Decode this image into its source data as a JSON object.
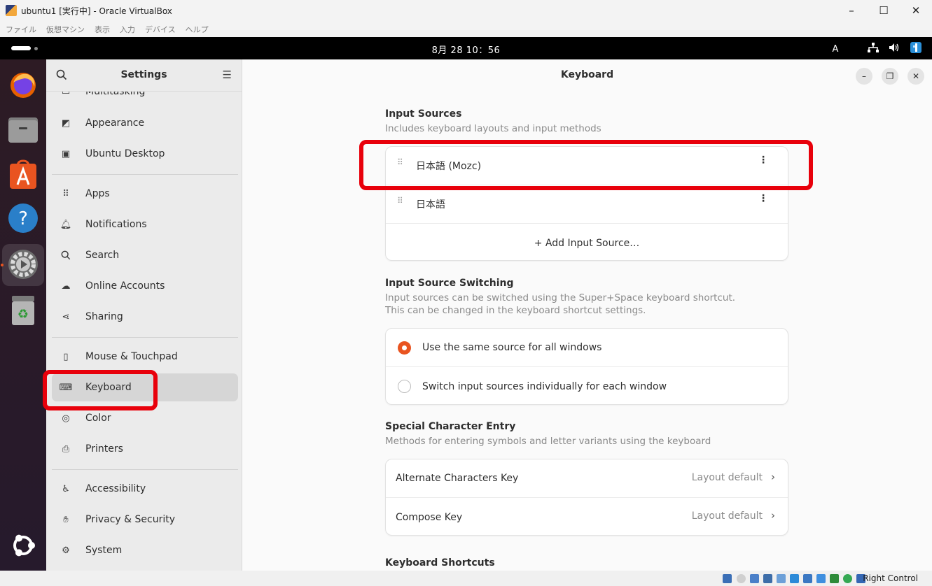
{
  "host_window": {
    "title": "ubuntu1 [実行中] - Oracle VirtualBox",
    "controls": {
      "minimize": "–",
      "maximize": "☐",
      "close": "✕"
    },
    "menu": [
      "ファイル",
      "仮想マシン",
      "表示",
      "入力",
      "デバイス",
      "ヘルプ"
    ],
    "status_right_label": "Right Control"
  },
  "topbar": {
    "clock": "8月 28  10：56",
    "input_indicator": "A",
    "network_icon": "network-icon",
    "volume_icon": "volume-icon",
    "ime_icon": "ime-icon"
  },
  "dock": {
    "apps": [
      "firefox-icon",
      "files-icon",
      "app-center-icon",
      "help-icon",
      "settings-icon",
      "trash-icon"
    ],
    "show_apps_icon": "ubuntu-logo-icon"
  },
  "sidebar": {
    "title": "Settings",
    "items": [
      {
        "label": "Multitasking",
        "icon": "multitasking-icon"
      },
      {
        "label": "Appearance",
        "icon": "appearance-icon"
      },
      {
        "label": "Ubuntu Desktop",
        "icon": "desktop-icon"
      },
      {
        "label": "Apps",
        "icon": "apps-icon"
      },
      {
        "label": "Notifications",
        "icon": "bell-icon"
      },
      {
        "label": "Search",
        "icon": "search-icon"
      },
      {
        "label": "Online Accounts",
        "icon": "cloud-icon"
      },
      {
        "label": "Sharing",
        "icon": "share-icon"
      },
      {
        "label": "Mouse & Touchpad",
        "icon": "mouse-icon"
      },
      {
        "label": "Keyboard",
        "icon": "keyboard-icon"
      },
      {
        "label": "Color",
        "icon": "color-icon"
      },
      {
        "label": "Printers",
        "icon": "printer-icon"
      },
      {
        "label": "Accessibility",
        "icon": "accessibility-icon"
      },
      {
        "label": "Privacy & Security",
        "icon": "hand-icon"
      },
      {
        "label": "System",
        "icon": "gear-icon"
      }
    ]
  },
  "content": {
    "title": "Keyboard",
    "input_sources": {
      "heading": "Input Sources",
      "description": "Includes keyboard layouts and input methods",
      "sources": [
        "日本語 (Mozc)",
        "日本語"
      ],
      "add_label": "+  Add Input Source…"
    },
    "switching": {
      "heading": "Input Source Switching",
      "description_line1": "Input sources can be switched using the Super+Space keyboard shortcut.",
      "description_line2": "This can be changed in the keyboard shortcut settings.",
      "options": [
        "Use the same source for all windows",
        "Switch input sources individually for each window"
      ],
      "selected_index": 0
    },
    "special_chars": {
      "heading": "Special Character Entry",
      "description": "Methods for entering symbols and letter variants using the keyboard",
      "rows": [
        {
          "label": "Alternate Characters Key",
          "value": "Layout default"
        },
        {
          "label": "Compose Key",
          "value": "Layout default"
        }
      ]
    },
    "shortcuts": {
      "heading": "Keyboard Shortcuts"
    }
  },
  "colors": {
    "accent": "#e95420",
    "highlight_box": "#e8000b",
    "topbar": "#000000",
    "sidebar_bg": "#ebebeb",
    "selected_item": "#d6d6d6"
  }
}
